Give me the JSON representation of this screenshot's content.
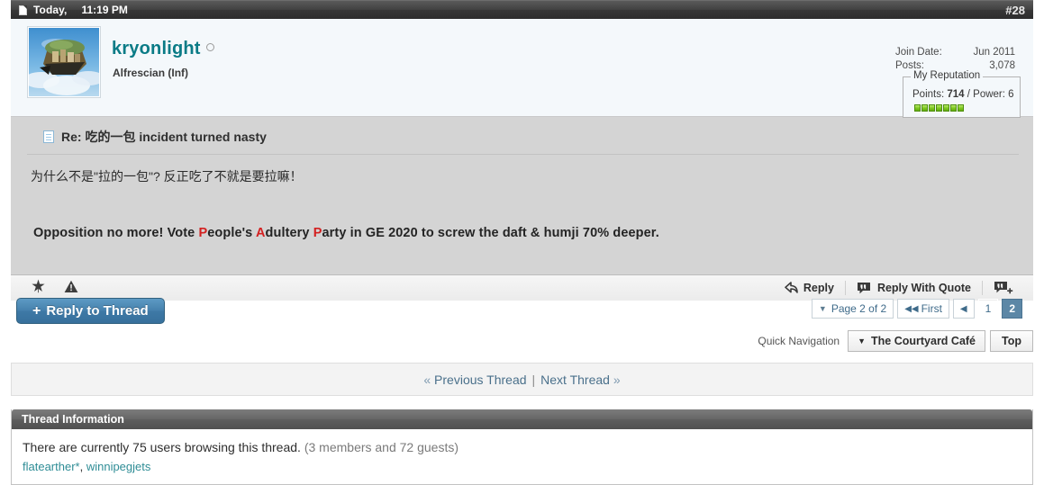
{
  "post": {
    "header": {
      "date": "Today,",
      "time": "11:19 PM",
      "post_number": "#28",
      "doc_icon": "document-icon"
    },
    "user": {
      "name": "kryonlight",
      "online_indicator": "offline-dot",
      "title": "Alfrescian (Inf)",
      "avatar_alt": "floating-island-avatar"
    },
    "stats": {
      "join_date_label": "Join Date:",
      "join_date_value": "Jun 2011",
      "posts_label": "Posts:",
      "posts_value": "3,078"
    },
    "reputation": {
      "legend": "My Reputation",
      "points_label": "Points:",
      "points_value": "714",
      "power_text": "/ Power: 6",
      "blocks": 7,
      "bar_color": "#7ec81f"
    },
    "content": {
      "title": "Re: 吃的一包 incident turned nasty",
      "body": "为什么不是\"拉的一包\"? 反正吃了不就是要拉嘛！",
      "signature_parts": [
        {
          "text": "Opposition no more! Vote ",
          "highlight": false
        },
        {
          "text": "P",
          "highlight": true
        },
        {
          "text": "eople's ",
          "highlight": false
        },
        {
          "text": "A",
          "highlight": true
        },
        {
          "text": "dultery ",
          "highlight": false
        },
        {
          "text": "P",
          "highlight": true
        },
        {
          "text": "arty in GE 2020 to screw the daft & humji 70% deeper.",
          "highlight": false
        }
      ],
      "signature_highlight_color": "#d32020"
    },
    "actions": {
      "star_icon": "star-icon",
      "warn_icon": "warning-triangle-icon",
      "reply": "Reply",
      "reply_with_quote": "Reply With Quote",
      "multiquote_icon": "multiquote-icon"
    }
  },
  "reply_bar": {
    "reply_to_thread": "Reply to Thread",
    "plus": "+",
    "accent_color": "#4580ac"
  },
  "pagination": {
    "page_label": "Page 2 of 2",
    "first_label": "First",
    "prev_label": "◀",
    "pages": [
      "1",
      "2"
    ],
    "selected_page": "2",
    "selected_color": "#5c87a6"
  },
  "quick_navigation": {
    "label": "Quick Navigation",
    "selected_forum": "The Courtyard Café",
    "top_button": "Top"
  },
  "thread_nav": {
    "prev_chevron": "«",
    "prev_label": "Previous Thread",
    "separator": "|",
    "next_label": "Next Thread",
    "next_chevron": "»"
  },
  "thread_information": {
    "heading": "Thread Information",
    "browsing_text": "There are currently 75 users browsing this thread.",
    "breakdown": "(3 members and 72 guests)",
    "users": [
      "flatearther*",
      "winnipegjets"
    ],
    "user_separator": ", "
  }
}
